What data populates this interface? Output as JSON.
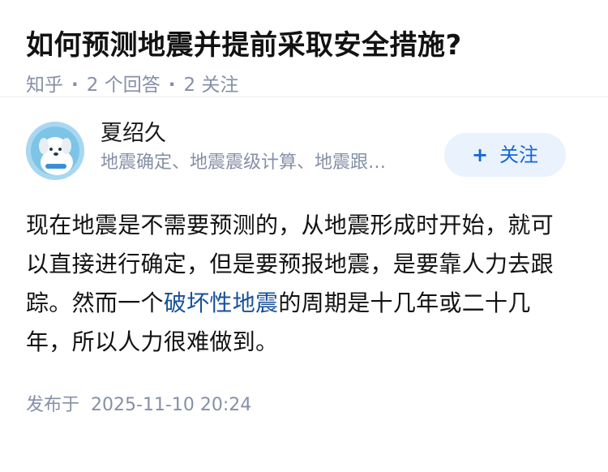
{
  "question": {
    "title": "如何预测地震并提前采取安全措施?",
    "source": "知乎",
    "answers_count": "2 个回答",
    "followers_count": "2 关注",
    "separator": "·"
  },
  "answer": {
    "author": {
      "name": "夏绍久",
      "bio": "地震确定、地震震级计算、地震跟…",
      "avatar_icon": "cartoon-dog-avatar-icon"
    },
    "follow_button": {
      "plus": "+",
      "label": "关注"
    },
    "content": {
      "part1": "现在地震是不需要预测的，从地震形成时开始，就可以直接进行确定，但是要预报地震，是要靠人力去跟踪。然而一个",
      "link": "破坏性地震",
      "part2": "的周期是十几年或二十几年，所以人力很难做到。"
    },
    "publish": {
      "label": "发布于",
      "time": "2025-11-10 20:24"
    }
  },
  "colors": {
    "accent": "#1366d7",
    "follow_bg": "#eaf2fd",
    "meta_gray": "#8590a6",
    "link": "#175199",
    "avatar_bg": "#9fd3ee"
  }
}
